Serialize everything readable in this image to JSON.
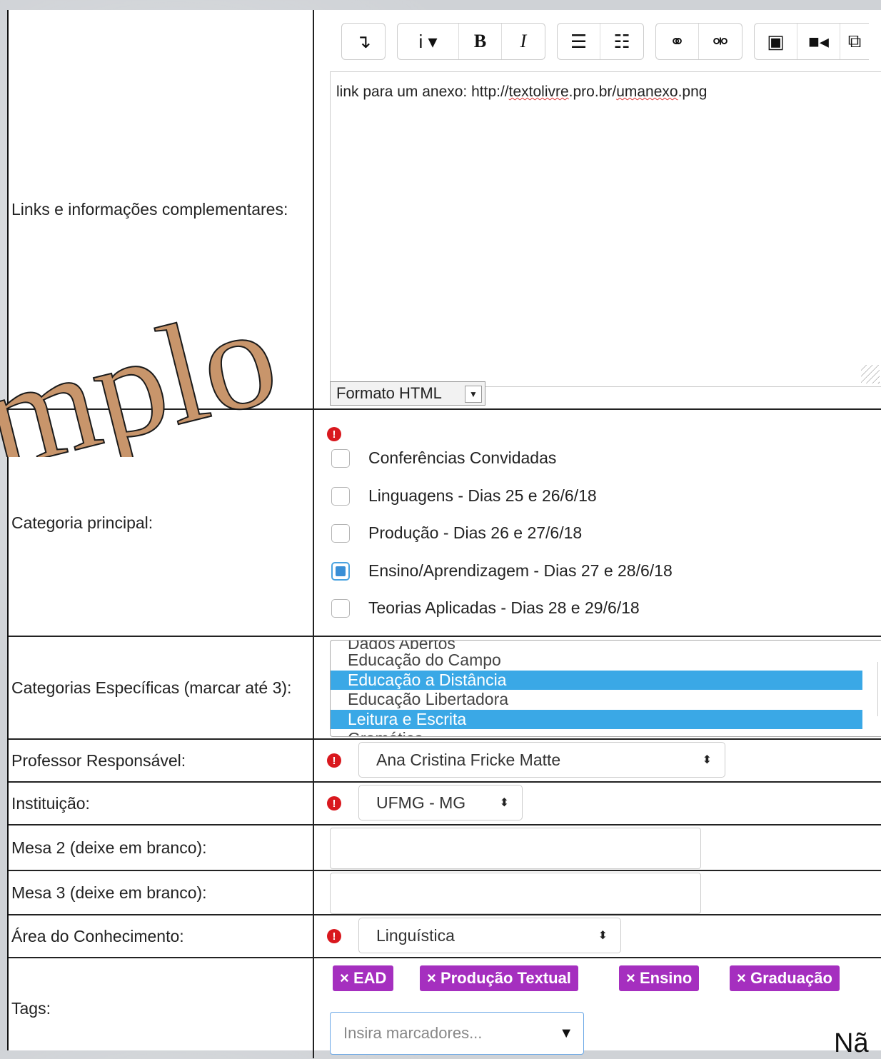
{
  "watermark": "mplo",
  "bottom_fragment": "Nã",
  "links_row": {
    "label": "Links e informações complementares:",
    "toolbar": {
      "groups": [
        [
          {
            "icon": "paragraph-icon",
            "glyph": "↴"
          }
        ],
        [
          {
            "icon": "info-dropdown-icon",
            "glyph": "i ▾"
          },
          {
            "icon": "bold-icon",
            "glyph": "B"
          },
          {
            "icon": "italic-icon",
            "glyph": "I"
          }
        ],
        [
          {
            "icon": "bullet-list-icon",
            "glyph": "☰"
          },
          {
            "icon": "numbered-list-icon",
            "glyph": "☷"
          }
        ],
        [
          {
            "icon": "link-icon",
            "glyph": "⚭"
          },
          {
            "icon": "unlink-icon",
            "glyph": "⚮"
          }
        ],
        [
          {
            "icon": "image-icon",
            "glyph": "▣"
          },
          {
            "icon": "video-icon",
            "glyph": "■◂"
          },
          {
            "icon": "copy-icon",
            "glyph": "⧉"
          }
        ]
      ]
    },
    "editor_text_prefix": "link para um anexo: http://",
    "editor_text_word1": "textolivre",
    "editor_text_mid": ".pro.br/",
    "editor_text_word2": "umanexo",
    "editor_text_suffix": ".png",
    "format_label": "Formato HTML"
  },
  "category_row": {
    "label": "Categoria principal:",
    "options": [
      {
        "label": "Conferências Convidadas",
        "checked": false
      },
      {
        "label": "Linguagens - Dias 25 e 26/6/18",
        "checked": false
      },
      {
        "label": "Produção - Dias 26 e 27/6/18",
        "checked": false
      },
      {
        "label": "Ensino/Aprendizagem - Dias 27 e 28/6/18",
        "checked": true
      },
      {
        "label": "Teorias Aplicadas - Dias 28 e 29/6/18",
        "checked": false
      }
    ]
  },
  "specific_row": {
    "label": "Categorias Específicas (marcar até 3):",
    "options": [
      {
        "label": "Dados Abertos",
        "selected": false
      },
      {
        "label": "Educação do Campo",
        "selected": false
      },
      {
        "label": "Educação a Distância",
        "selected": true
      },
      {
        "label": "Educação Libertadora",
        "selected": false
      },
      {
        "label": "Leitura e Escrita",
        "selected": true
      },
      {
        "label": "Gramática",
        "selected": false
      }
    ]
  },
  "professor_row": {
    "label": "Professor Responsável:",
    "value": "Ana Cristina Fricke Matte"
  },
  "institution_row": {
    "label": "Instituição:",
    "value": "UFMG - MG"
  },
  "mesa2_row": {
    "label": "Mesa 2 (deixe em branco):",
    "value": ""
  },
  "mesa3_row": {
    "label": "Mesa 3 (deixe em branco):",
    "value": ""
  },
  "area_row": {
    "label": "Área do Conhecimento:",
    "value": "Linguística"
  },
  "tags_row": {
    "label": "Tags:",
    "tags": [
      "× EAD",
      "× Produção Textual",
      "× Ensino",
      "× Graduação"
    ],
    "placeholder": "Insira marcadores..."
  },
  "colors": {
    "required": "#d9181e",
    "selection": "#3aa8e6",
    "tag": "#a52fbf",
    "watermark": "#c8956b"
  }
}
